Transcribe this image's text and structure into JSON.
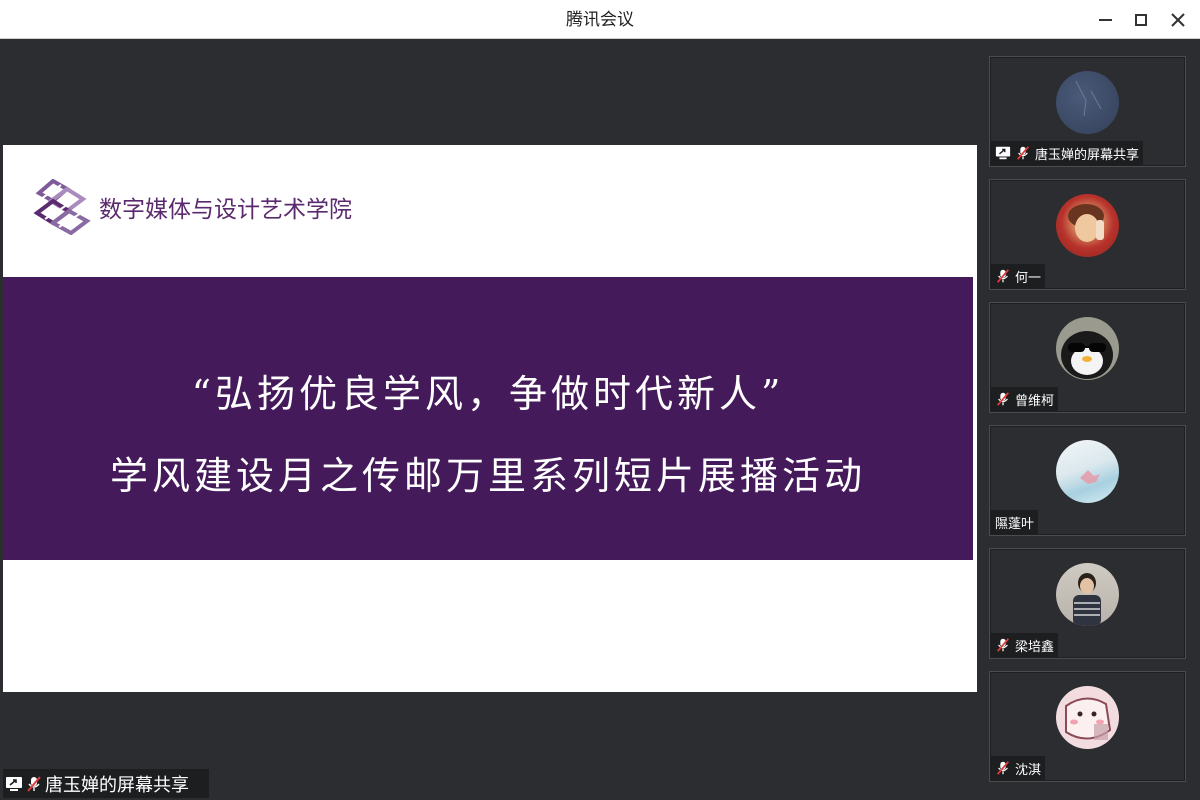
{
  "window": {
    "title": "腾讯会议",
    "minimize_label": "minimize",
    "maximize_label": "maximize",
    "close_label": "close"
  },
  "slide": {
    "logo_text": "数字媒体与设计艺术学院",
    "banner_line1": "“弘扬优良学风，争做时代新人”",
    "banner_line2": "学风建设月之传邮万里系列短片展播活动",
    "banner_color": "#441a5a"
  },
  "share_label": {
    "text": "唐玉婵的屏幕共享",
    "icons": [
      "screen-share-icon",
      "mic-muted-icon"
    ]
  },
  "participants": [
    {
      "name": "唐玉婵的屏幕共享",
      "sharing": true,
      "muted": true,
      "avatar": "dark-blue-texture"
    },
    {
      "name": "何一",
      "sharing": false,
      "muted": true,
      "avatar": "red-photo"
    },
    {
      "name": "曾维柯",
      "sharing": false,
      "muted": true,
      "avatar": "penguin-sunglasses"
    },
    {
      "name": "隰蓬叶",
      "sharing": false,
      "muted": false,
      "avatar": "light-blue-pink"
    },
    {
      "name": "梁培鑫",
      "sharing": false,
      "muted": true,
      "avatar": "person-sweater"
    },
    {
      "name": "沈淇",
      "sharing": false,
      "muted": true,
      "avatar": "pink-cartoon"
    }
  ]
}
